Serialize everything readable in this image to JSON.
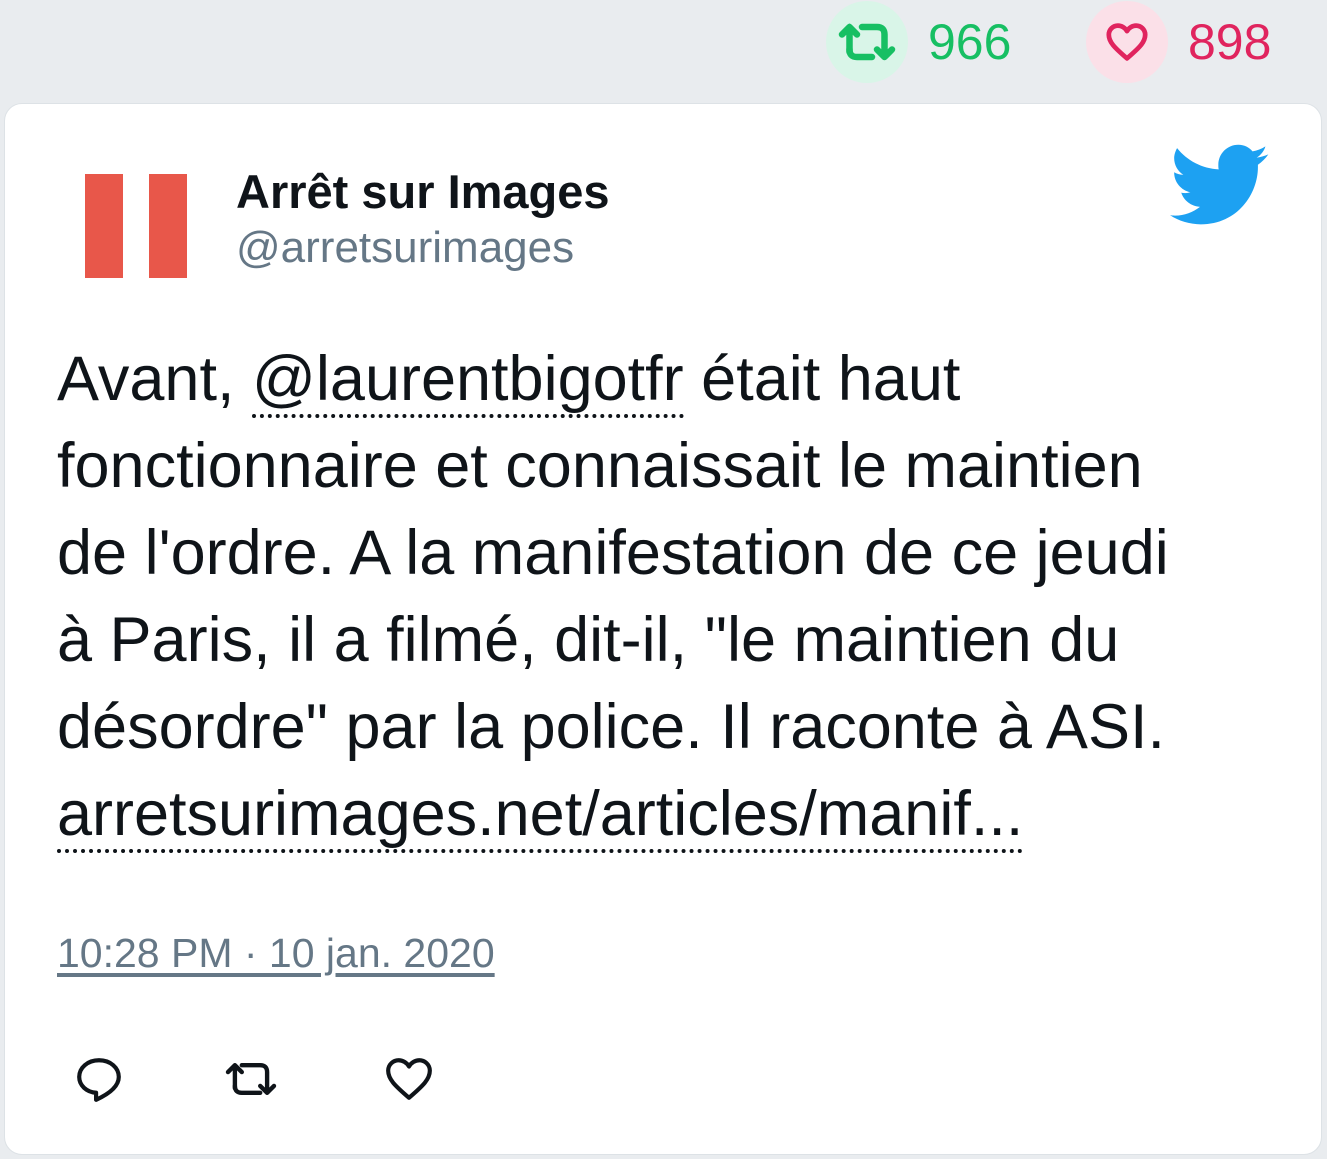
{
  "stats": {
    "retweets": "966",
    "likes": "898",
    "retweet_color": "#17bf63",
    "like_color": "#e0245e"
  },
  "tweet": {
    "author_name": "Arrêt sur Images",
    "author_handle": "@arretsurimages",
    "avatar_icon": "pause-icon",
    "brand_icon": "twitter-bird-icon",
    "text": {
      "line1_before": "Avant, ",
      "mention": "@laurentbigotfr",
      "line1_after": " était haut",
      "line2": "fonctionnaire et connaissait le maintien",
      "line3": "de l'ordre. A la manifestation de ce jeudi",
      "line4": "à Paris, il a filmé, dit-il, \"le maintien du",
      "line5": "désordre\" par la police. Il raconte à ASI.",
      "link": "arretsurimages.net/articles/manif..."
    },
    "timestamp": "10:28 PM · 10 jan. 2020"
  },
  "actions": {
    "reply_icon": "reply-icon",
    "retweet_icon": "retweet-icon",
    "like_icon": "heart-icon"
  }
}
